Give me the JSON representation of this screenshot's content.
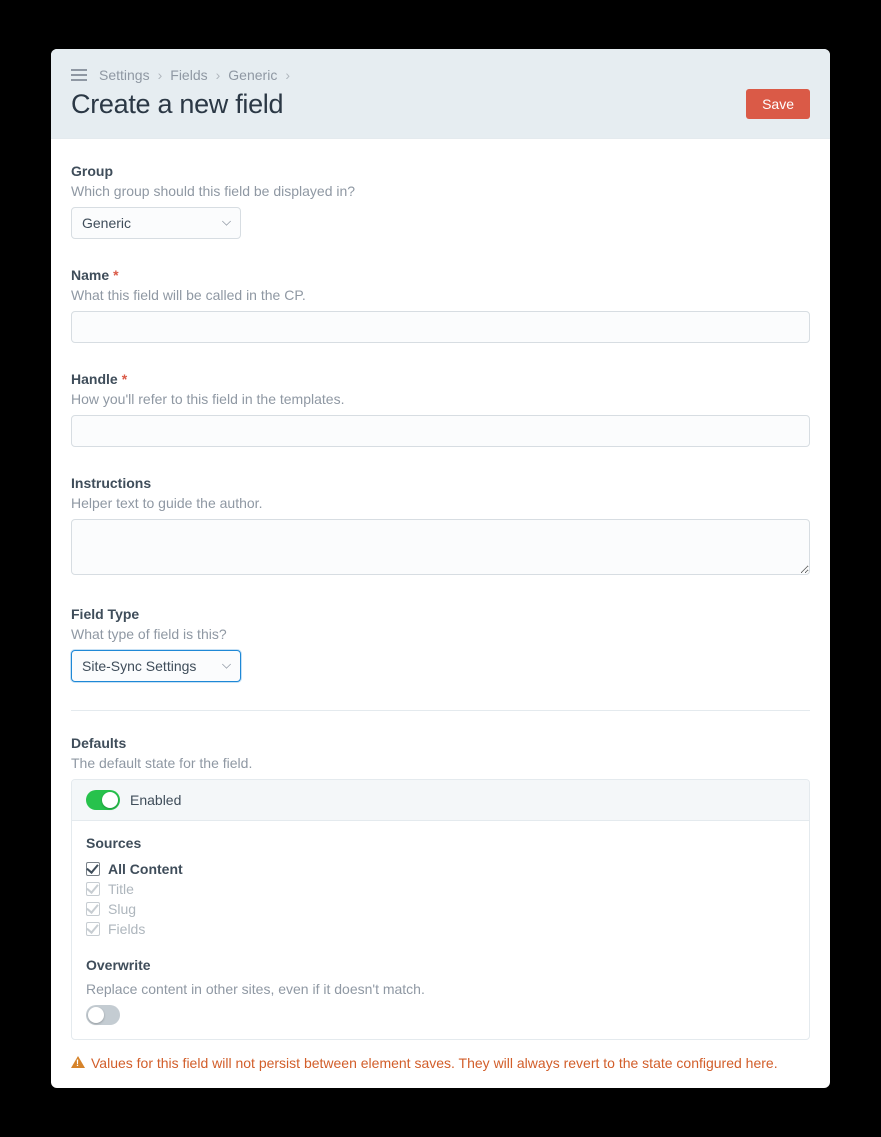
{
  "breadcrumbs": [
    "Settings",
    "Fields",
    "Generic"
  ],
  "page_title": "Create a new field",
  "save_label": "Save",
  "fields": {
    "group": {
      "label": "Group",
      "instructions": "Which group should this field be displayed in?",
      "value": "Generic"
    },
    "name": {
      "label": "Name",
      "instructions": "What this field will be called in the CP.",
      "required": true,
      "value": ""
    },
    "handle": {
      "label": "Handle",
      "instructions": "How you'll refer to this field in the templates.",
      "required": true,
      "value": ""
    },
    "instructions": {
      "label": "Instructions",
      "instructions": "Helper text to guide the author.",
      "value": ""
    },
    "field_type": {
      "label": "Field Type",
      "instructions": "What type of field is this?",
      "value": "Site-Sync Settings"
    }
  },
  "defaults": {
    "label": "Defaults",
    "instructions": "The default state for the field.",
    "enabled_label": "Enabled",
    "enabled": true,
    "sources": {
      "label": "Sources",
      "items": [
        {
          "label": "All Content",
          "checked": true,
          "disabled": false,
          "bold": true
        },
        {
          "label": "Title",
          "checked": true,
          "disabled": true,
          "bold": false
        },
        {
          "label": "Slug",
          "checked": true,
          "disabled": true,
          "bold": false
        },
        {
          "label": "Fields",
          "checked": true,
          "disabled": true,
          "bold": false
        }
      ]
    },
    "overwrite": {
      "label": "Overwrite",
      "instructions": "Replace content in other sites, even if it doesn't match.",
      "enabled": false
    }
  },
  "notice": "Values for this field will not persist between element saves. They will always revert to the state configured here."
}
